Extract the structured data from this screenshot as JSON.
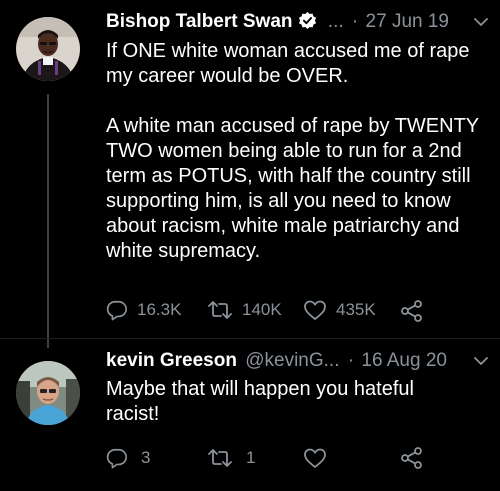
{
  "colors": {
    "background": "#000000",
    "text": "#ffffff",
    "muted": "#8b9299",
    "thread_line": "#3d4147"
  },
  "tweets": [
    {
      "display_name": "Bishop Talbert Swan",
      "verified": true,
      "handle_truncated": "...",
      "separator": "·",
      "date": "27 Jun 19",
      "paragraphs": [
        "If ONE white woman accused me of rape my career would be OVER.",
        "A white man accused of rape by TWENTY TWO women being able to run for a 2nd term as POTUS, with half the country still supporting him, is all you need to know about racism, white male patriarchy and white supremacy."
      ],
      "replies": "16.3K",
      "retweets": "140K",
      "likes": "435K",
      "icons": [
        "reply-icon",
        "retweet-icon",
        "like-icon",
        "share-icon"
      ]
    },
    {
      "display_name": "kevin Greeson",
      "handle": "@kevinG...",
      "separator": "·",
      "date": "16 Aug 20",
      "paragraphs": [
        "Maybe that will happen you hateful racist!"
      ],
      "replies": "3",
      "retweets": "1",
      "likes": "",
      "icons": [
        "reply-icon",
        "retweet-icon",
        "like-icon",
        "share-icon"
      ]
    }
  ]
}
